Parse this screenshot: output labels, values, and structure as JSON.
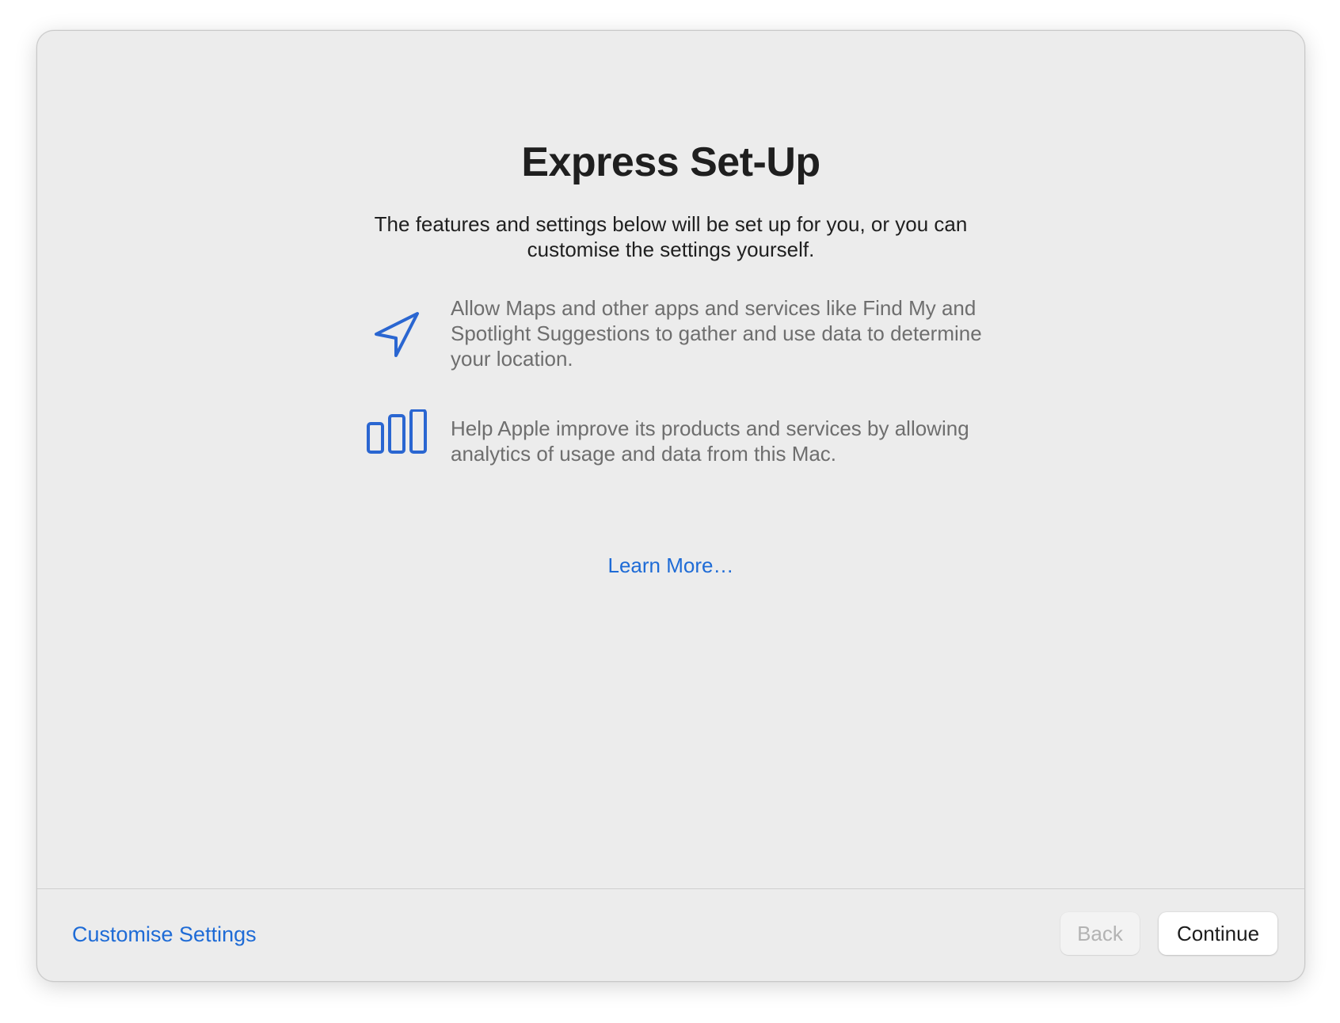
{
  "header": {
    "title": "Express Set-Up",
    "subtitle": "The features and settings below will be set up for you, or you can customise the settings yourself."
  },
  "features": [
    {
      "icon": "location-arrow-icon",
      "text": "Allow Maps and other apps and services like Find My and Spotlight Suggestions to gather and use data to determine your location."
    },
    {
      "icon": "analytics-bars-icon",
      "text": "Help Apple improve its products and services by allowing analytics of usage and data from this Mac."
    }
  ],
  "learn_more": "Learn More…",
  "footer": {
    "customise_label": "Customise Settings",
    "back_label": "Back",
    "continue_label": "Continue"
  },
  "colors": {
    "accent": "#1e6bd6",
    "icon_blue": "#2a66d1",
    "window_bg": "#ececec",
    "body_text": "#1f1f1f",
    "secondary_text": "#6e6e6e",
    "disabled_text": "#b3b3b3"
  }
}
